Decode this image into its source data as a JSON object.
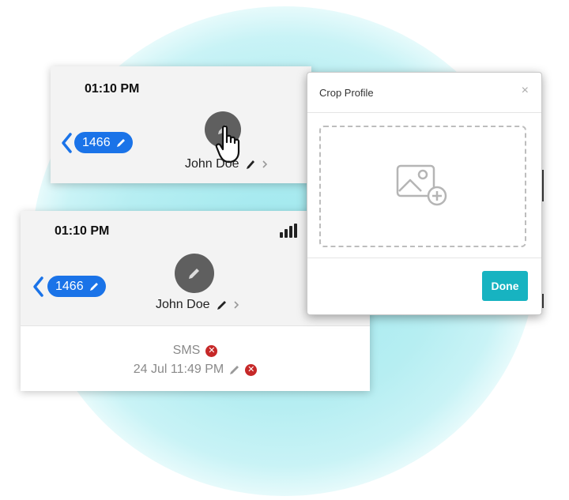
{
  "top_card": {
    "time": "01:10 PM",
    "contact_count": "1466",
    "contact_name": "John Doe"
  },
  "bottom_card": {
    "time": "01:10 PM",
    "contact_count": "1466",
    "contact_name": "John Doe",
    "message_type": "SMS",
    "message_timestamp": "24 Jul 11:49 PM"
  },
  "modal": {
    "title": "Crop Profile",
    "close_label": "×",
    "done_label": "Done"
  },
  "colors": {
    "accent_blue": "#1a73e8",
    "done_teal": "#17b3c1",
    "delete_red": "#c62828"
  },
  "icons": [
    "back-chevron-icon",
    "edit-pencil-icon",
    "avatar-icon",
    "pointer-hand-icon",
    "chevron-right-icon",
    "signal-icon",
    "delete-icon",
    "add-image-icon",
    "close-icon"
  ]
}
